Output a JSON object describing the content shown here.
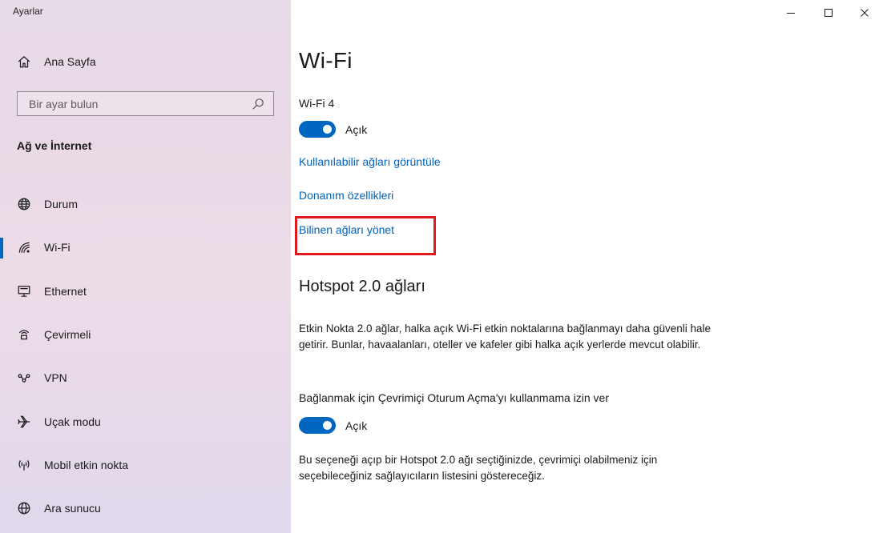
{
  "window": {
    "app_title": "Ayarlar"
  },
  "sidebar": {
    "home_label": "Ana Sayfa",
    "search_placeholder": "Bir ayar bulun",
    "section_heading": "Ağ ve İnternet",
    "items": [
      {
        "label": "Durum",
        "icon": "globe-status-icon",
        "selected": false
      },
      {
        "label": "Wi-Fi",
        "icon": "wifi-icon",
        "selected": true
      },
      {
        "label": "Ethernet",
        "icon": "ethernet-icon",
        "selected": false
      },
      {
        "label": "Çevirmeli",
        "icon": "dialup-icon",
        "selected": false
      },
      {
        "label": "VPN",
        "icon": "vpn-icon",
        "selected": false
      },
      {
        "label": "Uçak modu",
        "icon": "airplane-icon",
        "selected": false
      },
      {
        "label": "Mobil etkin nokta",
        "icon": "hotspot-icon",
        "selected": false
      },
      {
        "label": "Ara sunucu",
        "icon": "proxy-globe-icon",
        "selected": false
      }
    ]
  },
  "main": {
    "title": "Wi-Fi",
    "adapter_name": "Wi-Fi 4",
    "wifi_toggle": {
      "state": "on",
      "label": "Açık"
    },
    "links": {
      "available_networks": "Kullanılabilir ağları görüntüle",
      "hardware_properties": "Donanım özellikleri",
      "manage_known_networks": "Bilinen ağları yönet"
    },
    "hotspot": {
      "title": "Hotspot 2.0 ağları",
      "description": "Etkin Nokta 2.0 ağlar, halka açık Wi-Fi etkin noktalarına bağlanmayı daha güvenli hale getirir. Bunlar, havaalanları, oteller ve kafeler gibi halka açık yerlerde mevcut olabilir.",
      "online_signup_label": "Bağlanmak için Çevrimiçi Oturum Açma'yı kullanmama izin ver",
      "online_signup_toggle": {
        "state": "on",
        "label": "Açık"
      },
      "footnote": "Bu seçeneği açıp bir Hotspot 2.0 ağı seçtiğinizde, çevrimiçi olabilmeniz için seçebileceğiniz sağlayıcıların listesini göstereceğiz."
    }
  },
  "colors": {
    "accent": "#0067c0",
    "link": "#0062b8",
    "highlight": "#e0191c"
  }
}
